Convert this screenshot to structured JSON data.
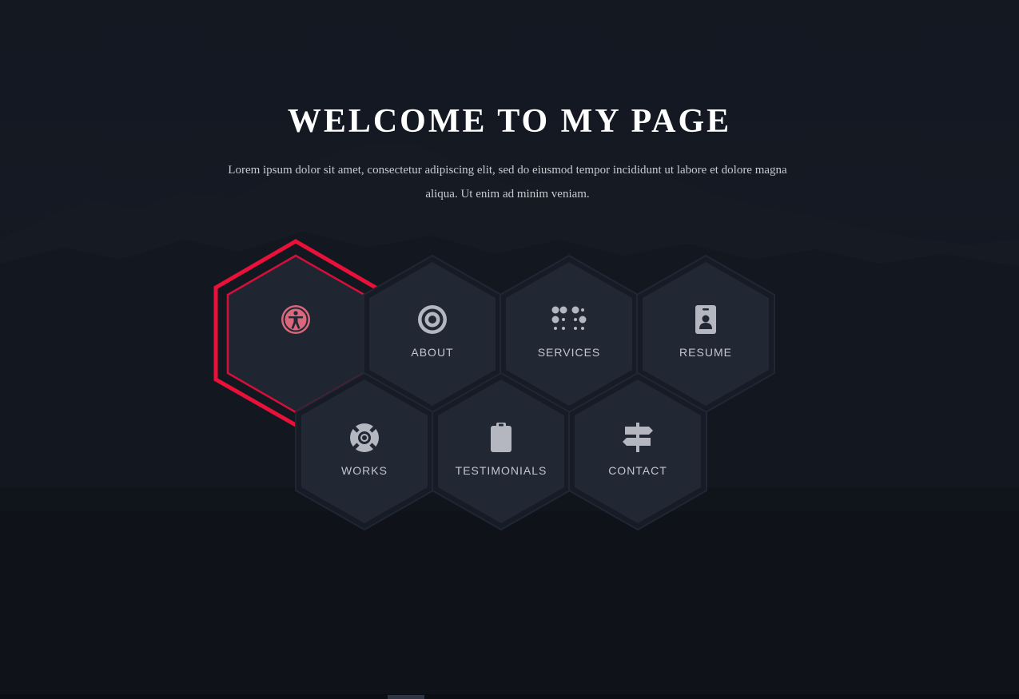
{
  "hero": {
    "title": "WELCOME TO MY PAGE",
    "intro": "Lorem ipsum dolor sit amet, consectetur adipiscing elit, sed do eiusmod tempor incididunt ut labore et dolore magna aliqua. Ut enim ad minim veniam."
  },
  "nav": {
    "items": [
      {
        "label": "",
        "icon": "accessibility-icon",
        "active": true
      },
      {
        "label": "ABOUT",
        "icon": "target-icon",
        "active": false
      },
      {
        "label": "SERVICES",
        "icon": "braille-icon",
        "active": false
      },
      {
        "label": "RESUME",
        "icon": "id-badge-icon",
        "active": false
      },
      {
        "label": "WORKS",
        "icon": "life-ring-icon",
        "active": false
      },
      {
        "label": "TESTIMONIALS",
        "icon": "clipboard-icon",
        "active": false
      },
      {
        "label": "CONTACT",
        "icon": "signpost-icon",
        "active": false
      }
    ]
  },
  "colors": {
    "background": "#12161e",
    "hex_fill": "#222734",
    "accent": "#e8113a",
    "icon": "#b4b7bf",
    "text": "#c2c6cf"
  }
}
